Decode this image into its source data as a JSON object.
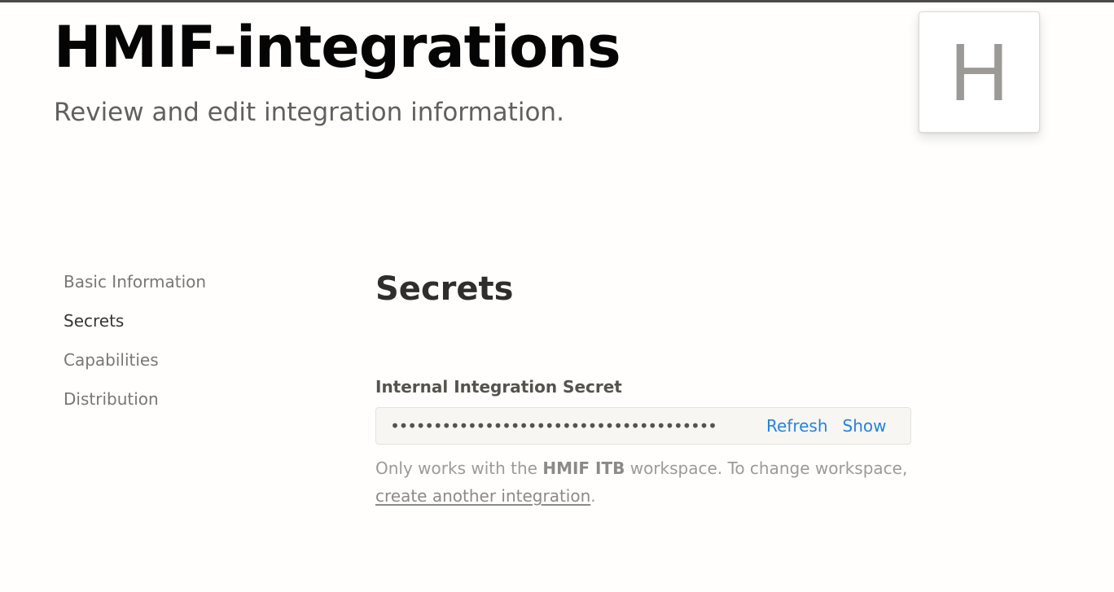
{
  "header": {
    "title": "HMIF-integrations",
    "subtitle": "Review and edit integration information.",
    "avatar_letter": "H"
  },
  "sidebar": {
    "items": [
      {
        "label": "Basic Information",
        "active": false
      },
      {
        "label": "Secrets",
        "active": true
      },
      {
        "label": "Capabilities",
        "active": false
      },
      {
        "label": "Distribution",
        "active": false
      }
    ]
  },
  "secrets": {
    "section_title": "Secrets",
    "field_label": "Internal Integration Secret",
    "masked_value": "••••••••••••••••••••••••••••••••••••••",
    "refresh_label": "Refresh",
    "show_label": "Show",
    "help": {
      "prefix": "Only works with the",
      "workspace_name": "HMIF ITB",
      "middle": "workspace. To change workspace,",
      "link_text": "create another integration",
      "suffix": "."
    }
  },
  "colors": {
    "link_blue": "#2383e2",
    "background": "#fffefd",
    "input_background": "#f7f6f3"
  }
}
